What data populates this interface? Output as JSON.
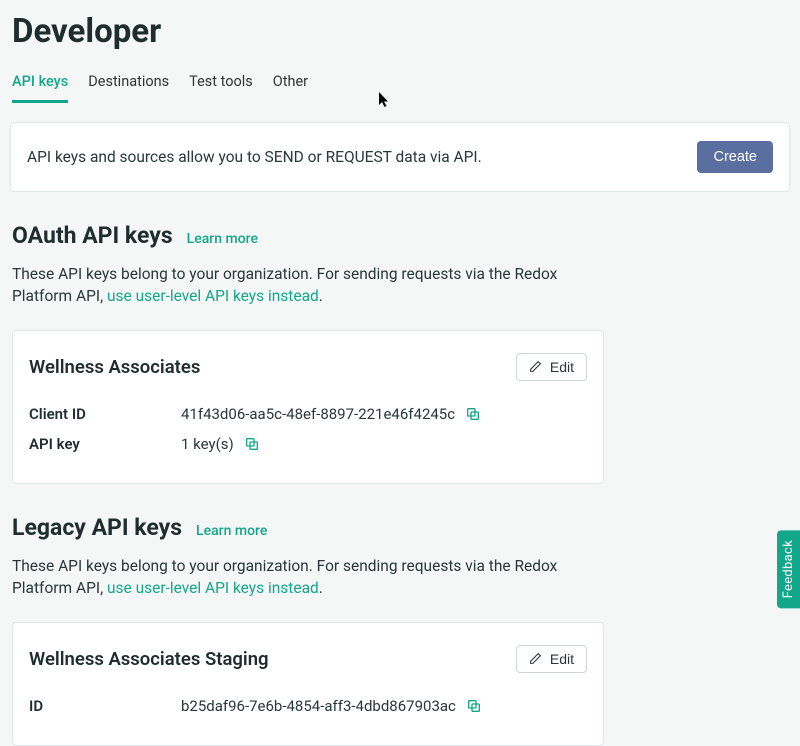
{
  "page": {
    "title": "Developer"
  },
  "tabs": [
    {
      "label": "API keys",
      "active": true
    },
    {
      "label": "Destinations",
      "active": false
    },
    {
      "label": "Test tools",
      "active": false
    },
    {
      "label": "Other",
      "active": false
    }
  ],
  "banner": {
    "text": "API keys and sources allow you to SEND or REQUEST data via API.",
    "create_label": "Create"
  },
  "oauth": {
    "title": "OAuth API keys",
    "learn_more": "Learn more",
    "desc_prefix": "These API keys belong to your organization. For sending requests via the Redox Platform API, ",
    "desc_link": "use user-level API keys instead",
    "desc_suffix": ".",
    "card": {
      "title": "Wellness Associates",
      "edit_label": "Edit",
      "rows": {
        "client_id_label": "Client ID",
        "client_id_value": "41f43d06-aa5c-48ef-8897-221e46f4245c",
        "api_key_label": "API key",
        "api_key_value": "1 key(s)"
      }
    }
  },
  "legacy": {
    "title": "Legacy API keys",
    "learn_more": "Learn more",
    "desc_prefix": "These API keys belong to your organization. For sending requests via the Redox Platform API, ",
    "desc_link": "use user-level API keys instead",
    "desc_suffix": ".",
    "card": {
      "title": "Wellness Associates Staging",
      "edit_label": "Edit",
      "rows": {
        "id_label": "ID",
        "id_value": "b25daf96-7e6b-4854-aff3-4dbd867903ac"
      }
    }
  },
  "feedback": {
    "label": "Feedback"
  }
}
